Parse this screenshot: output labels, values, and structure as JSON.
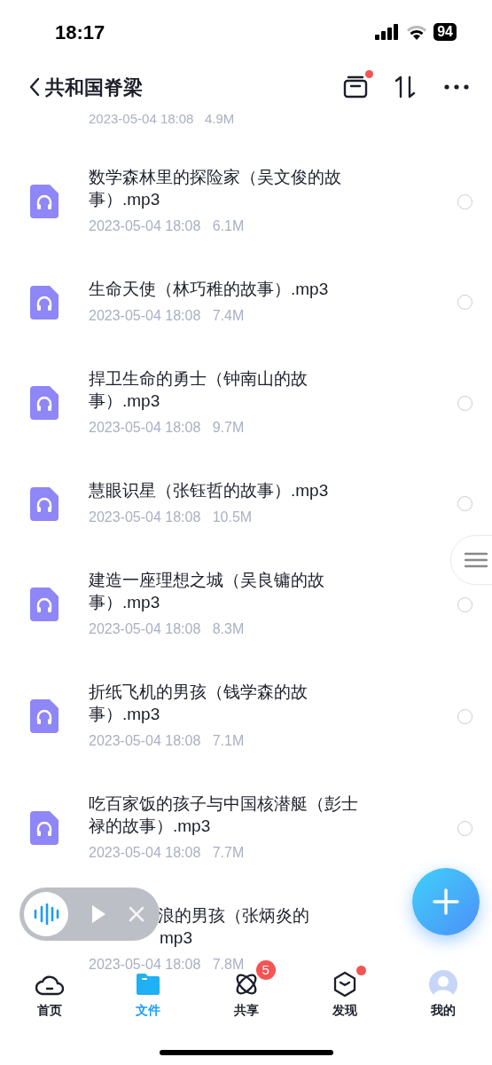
{
  "status_bar": {
    "time": "18:17",
    "battery": "94"
  },
  "header": {
    "title": "共和国脊梁",
    "recycle_badge": true
  },
  "top_meta": "2023-05-04 18:08   4.9M",
  "files": [
    {
      "name": "数学森林里的探险家（吴文俊的故事）.mp3",
      "date": "2023-05-04 18:08",
      "size": "6.1M",
      "selected": false
    },
    {
      "name": "生命天使（林巧稚的故事）.mp3",
      "date": "2023-05-04 18:08",
      "size": "7.4M",
      "selected": false
    },
    {
      "name": "捍卫生命的勇士（钟南山的故事）.mp3",
      "date": "2023-05-04 18:08",
      "size": "9.7M",
      "selected": false
    },
    {
      "name": "慧眼识星（张钰哲的故事）.mp3",
      "date": "2023-05-04 18:08",
      "size": "10.5M",
      "selected": false
    },
    {
      "name": "建造一座理想之城（吴良镛的故事）.mp3",
      "date": "2023-05-04 18:08",
      "size": "8.3M",
      "selected": false
    },
    {
      "name": "折纸飞机的男孩（钱学森的故事）.mp3",
      "date": "2023-05-04 18:08",
      "size": "7.1M",
      "selected": false
    },
    {
      "name": "吃百家饭的孩子与中国核潜艇（彭士禄的故事）.mp3",
      "date": "2023-05-04 18:08",
      "size": "7.7M",
      "selected": false
    },
    {
      "kind": "partly_hidden",
      "name_lines": [
        "浪的男孩（张炳炎的",
        "mp3"
      ],
      "date": "2023-05-04 18:08",
      "size": "7.8M"
    }
  ],
  "tabs": [
    {
      "kind": "home",
      "label": "首页",
      "selected": false
    },
    {
      "kind": "files",
      "label": "文件",
      "selected": true
    },
    {
      "kind": "share",
      "label": "共享",
      "selected": false,
      "badge": "5"
    },
    {
      "kind": "discover",
      "label": "发现",
      "selected": false,
      "dot": true
    },
    {
      "kind": "me",
      "label": "我的",
      "selected": false
    }
  ]
}
